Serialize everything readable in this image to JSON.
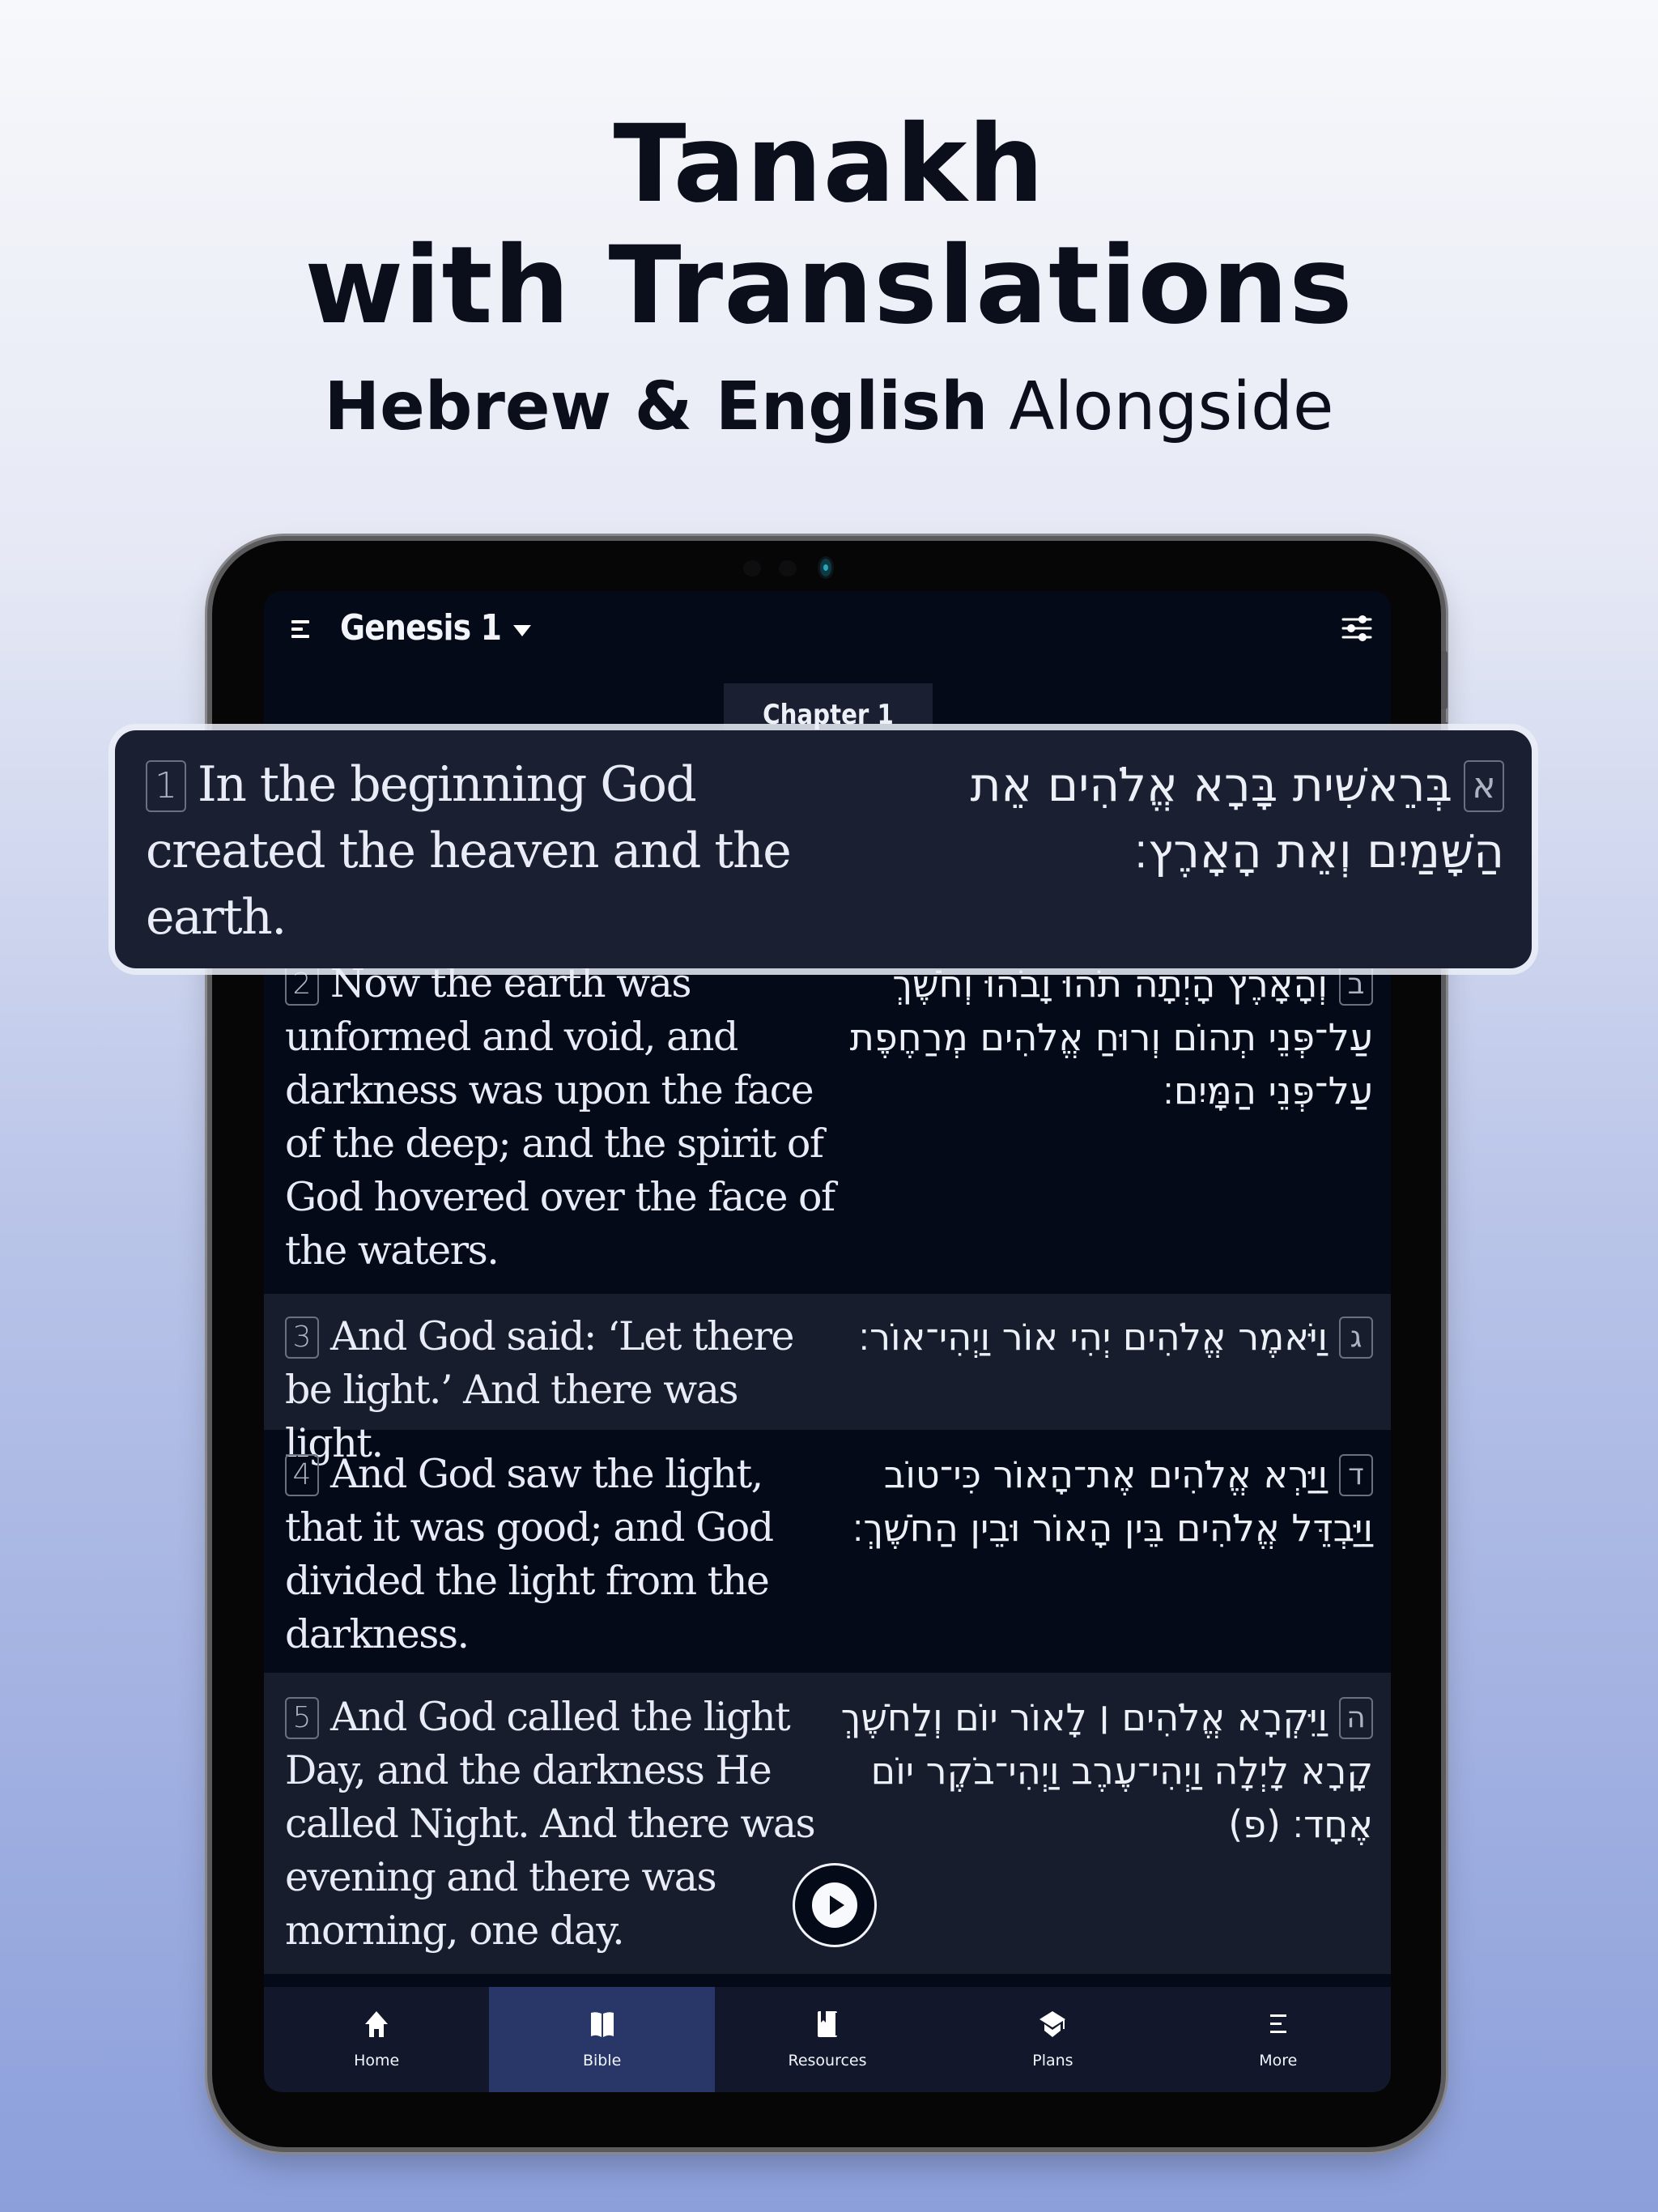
{
  "promo": {
    "title_line1": "Tanakh",
    "title_line2": "with Translations",
    "subtitle_bold": "Hebrew & English",
    "subtitle_light": "Alongside"
  },
  "app": {
    "header": {
      "title": "Genesis 1",
      "menu_icon": "hamburger-menu-icon",
      "dropdown_icon": "caret-down-icon",
      "settings_icon": "sliders-icon"
    },
    "chapter_tab": "Chapter 1",
    "verses": [
      {
        "number": "1",
        "hebrew_number": "א",
        "english": "In the beginning God created the heaven and the earth.",
        "hebrew": "בְּרֵאשִׁית בָּרָא אֱלֹהִים אֵת הַשָּׁמַיִם וְאֵת הָאָרֶץ׃",
        "highlighted": true
      },
      {
        "number": "2",
        "hebrew_number": "ב",
        "english": "Now the earth was unformed and void, and darkness was upon the face of the deep; and the spirit of God hovered over the face of the waters.",
        "hebrew": "וְהָאָרֶץ הָיְתָה תֹהוּ וָבֹהוּ וְחֹשֶׁךְ עַל־פְּנֵי תְהוֹם וְרוּחַ אֱלֹהִים מְרַחֶפֶת עַל־פְּנֵי הַמָּיִם׃"
      },
      {
        "number": "3",
        "hebrew_number": "ג",
        "english": "And God said: ‘Let there be light.’ And there was light.",
        "hebrew": "וַיֹּאמֶר אֱלֹהִים יְהִי אוֹר וַיְהִי־אוֹר׃"
      },
      {
        "number": "4",
        "hebrew_number": "ד",
        "english": "And God saw the light, that it was good; and God divided the light from the darkness.",
        "hebrew": "וַיַּרְא אֱלֹהִים אֶת־הָאוֹר כִּי־טוֹב וַיַּבְדֵּל אֱלֹהִים בֵּין הָאוֹר וּבֵין הַחֹשֶׁךְ׃"
      },
      {
        "number": "5",
        "hebrew_number": "ה",
        "english": "And God called the light Day, and the darkness He called Night. And there was evening and there was morning, one day.",
        "hebrew": "וַיִּקְרָא אֱלֹהִים ׀ לָאוֹר יוֹם וְלַחֹשֶׁךְ קָרָא לָיְלָה וַיְהִי־עֶרֶב וַיְהִי־בֹקֶר יוֹם אֶחָד׃ (פ)"
      }
    ],
    "audio": {
      "play_icon": "play-icon"
    },
    "bottom_nav": [
      {
        "label": "Home",
        "icon": "home-icon",
        "active": false
      },
      {
        "label": "Bible",
        "icon": "open-book-icon",
        "active": true
      },
      {
        "label": "Resources",
        "icon": "bookmark-book-icon",
        "active": false
      },
      {
        "label": "Plans",
        "icon": "graduation-cap-icon",
        "active": false
      },
      {
        "label": "More",
        "icon": "more-menu-icon",
        "active": false
      }
    ]
  },
  "colors": {
    "screen_bg": "#050a18",
    "alt_row_bg": "#181d2e",
    "active_tab_bg": "#283668",
    "nav_bg": "#12172b",
    "headline_text": "#0b0f1c"
  }
}
